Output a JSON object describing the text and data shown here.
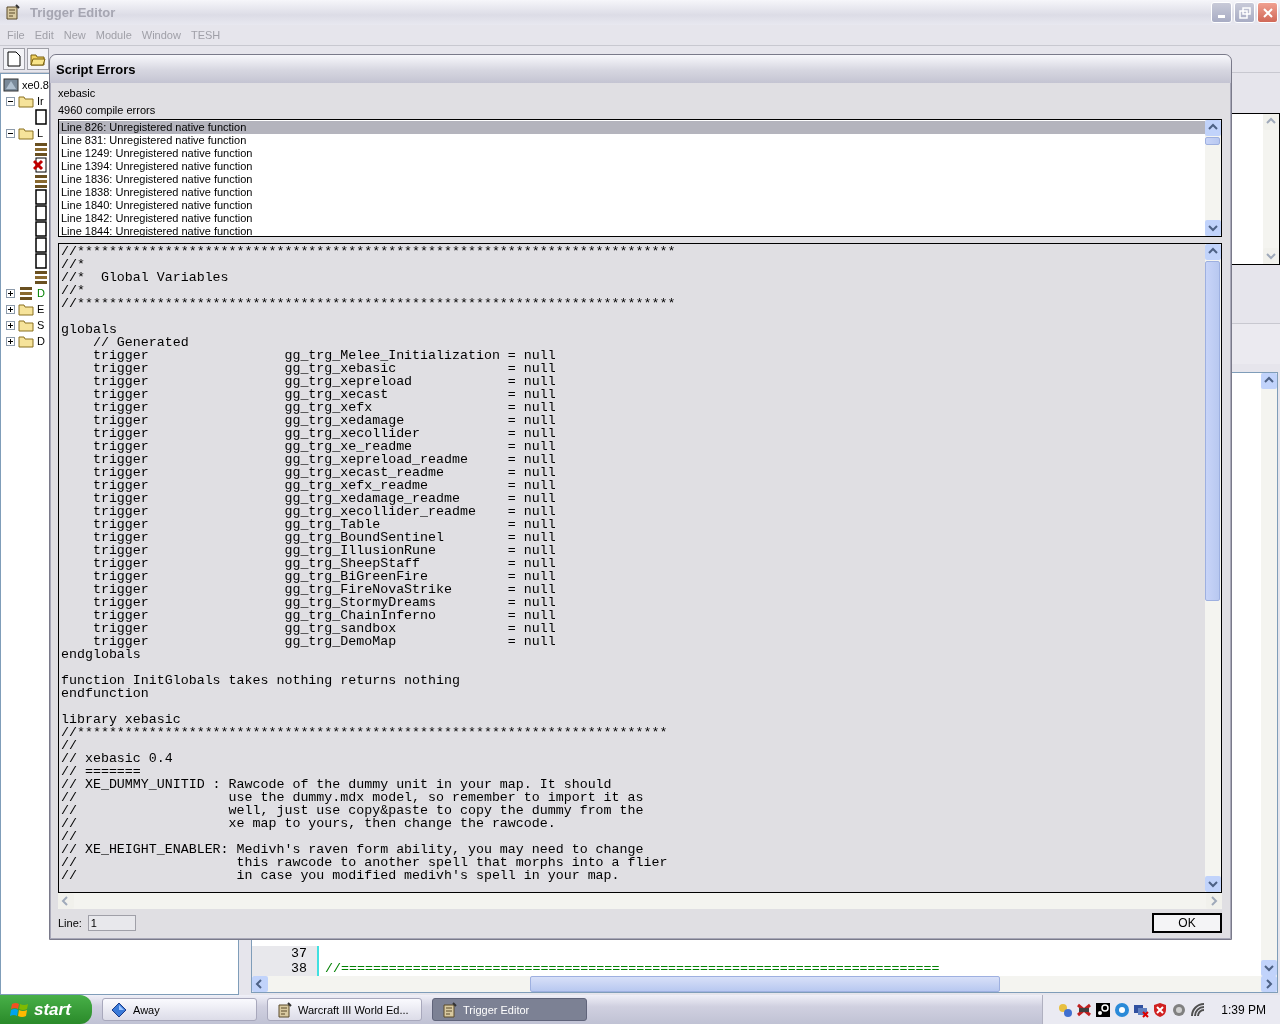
{
  "window": {
    "title": "Trigger Editor",
    "active": false
  },
  "menu": [
    {
      "label": "File",
      "disabled": true
    },
    {
      "label": "Edit",
      "disabled": true
    },
    {
      "label": "New",
      "disabled": true
    },
    {
      "label": "Module",
      "disabled": true
    },
    {
      "label": "Window",
      "disabled": true
    },
    {
      "label": "TESH",
      "disabled": true
    }
  ],
  "tree": [
    {
      "label": "xe0.8",
      "kind": "map",
      "children": [
        {
          "label": "Ir",
          "kind": "folder",
          "expanded": true,
          "children": [
            {
              "kind": "trigger"
            }
          ]
        },
        {
          "label": "L",
          "kind": "folder",
          "expanded": true,
          "children": [
            {
              "kind": "script"
            },
            {
              "kind": "error"
            },
            {
              "kind": "script"
            },
            {
              "kind": "trigger"
            },
            {
              "kind": "trigger"
            },
            {
              "kind": "trigger"
            },
            {
              "kind": "trigger"
            },
            {
              "kind": "trigger"
            },
            {
              "kind": "script"
            }
          ]
        },
        {
          "label": "D",
          "kind": "script",
          "expanded": false,
          "color": "#008000"
        },
        {
          "label": "E",
          "kind": "folder",
          "expanded": false
        },
        {
          "label": "S",
          "kind": "folder",
          "expanded": false
        },
        {
          "label": "D",
          "kind": "folder",
          "expanded": false
        }
      ]
    }
  ],
  "editor": {
    "rows": [
      {
        "number": "37"
      },
      {
        "number": "38",
        "code": "//===========================================================================",
        "comment": true
      }
    ]
  },
  "dialog": {
    "title": "Script Errors",
    "script": "xebasic",
    "summary": "4960 compile errors",
    "errors": [
      {
        "text": "Line 826: Unregistered native function",
        "selected": true
      },
      {
        "text": "Line 831: Unregistered native function",
        "selected": false
      },
      {
        "text": "Line 1249: Unregistered native function",
        "selected": false
      },
      {
        "text": "Line 1394: Unregistered native function",
        "selected": false
      },
      {
        "text": "Line 1836: Unregistered native function",
        "selected": false
      },
      {
        "text": "Line 1838: Unregistered native function",
        "selected": false
      },
      {
        "text": "Line 1840: Unregistered native function",
        "selected": false
      },
      {
        "text": "Line 1842: Unregistered native function",
        "selected": false
      },
      {
        "text": "Line 1844: Unregistered native function",
        "selected": false
      }
    ],
    "code": "//***************************************************************************\n//*\n//*  Global Variables\n//*\n//***************************************************************************\n\nglobals\n    // Generated\n    trigger                 gg_trg_Melee_Initialization = null\n    trigger                 gg_trg_xebasic              = null\n    trigger                 gg_trg_xepreload            = null\n    trigger                 gg_trg_xecast               = null\n    trigger                 gg_trg_xefx                 = null\n    trigger                 gg_trg_xedamage             = null\n    trigger                 gg_trg_xecollider           = null\n    trigger                 gg_trg_xe_readme            = null\n    trigger                 gg_trg_xepreload_readme     = null\n    trigger                 gg_trg_xecast_readme        = null\n    trigger                 gg_trg_xefx_readme          = null\n    trigger                 gg_trg_xedamage_readme      = null\n    trigger                 gg_trg_xecollider_readme    = null\n    trigger                 gg_trg_Table                = null\n    trigger                 gg_trg_BoundSentinel        = null\n    trigger                 gg_trg_IllusionRune         = null\n    trigger                 gg_trg_SheepStaff           = null\n    trigger                 gg_trg_BiGreenFire          = null\n    trigger                 gg_trg_FireNovaStrike       = null\n    trigger                 gg_trg_StormyDreams         = null\n    trigger                 gg_trg_ChainInferno         = null\n    trigger                 gg_trg_sandbox              = null\n    trigger                 gg_trg_DemoMap              = null\nendglobals\n\nfunction InitGlobals takes nothing returns nothing\nendfunction\n\nlibrary xebasic\n//**************************************************************************\n//\n// xebasic 0.4\n// =======\n// XE_DUMMY_UNITID : Rawcode of the dummy unit in your map. It should\n//                   use the dummy.mdx model, so remember to import it as\n//                   well, just use copy&paste to copy the dummy from the\n//                   xe map to yours, then change the rawcode.\n//\n// XE_HEIGHT_ENABLER: Medivh's raven form ability, you may need to change\n//                    this rawcode to another spell that morphs into a flier\n//                    in case you modified medivh's spell in your map.",
    "line_label": "Line:",
    "line_value": "1",
    "ok": "OK"
  },
  "taskbar": {
    "start": "start",
    "tasks": [
      {
        "label": "Away",
        "selected": false
      },
      {
        "label": "Warcraft III World Ed...",
        "selected": false
      },
      {
        "label": "Trigger Editor",
        "selected": true
      }
    ],
    "clock": "1:39 PM"
  }
}
